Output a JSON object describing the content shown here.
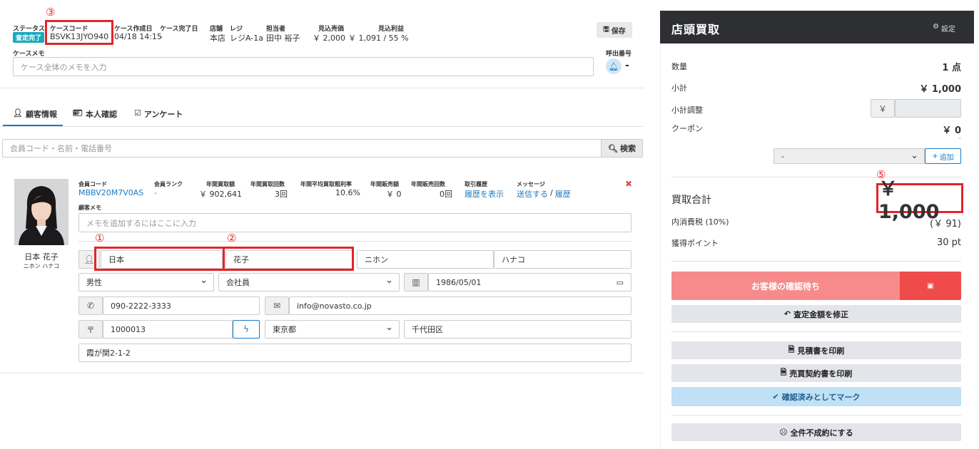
{
  "case": {
    "status_label": "ステータス",
    "status_badge": "査定完了",
    "code_label": "ケースコード",
    "code_value": "BSVK13JYO940",
    "created_label": "ケース作成日",
    "created_value": "04/18 14:15",
    "completed_label": "ケース完了日",
    "completed_value": "-",
    "store_label": "店舗",
    "store_value": "本店",
    "register_label": "レジ",
    "register_value": "レジA-1a",
    "staff_label": "担当者",
    "staff_value": "田中 裕子",
    "est_sale_label": "見込売価",
    "est_sale_value": "￥ 2,000",
    "est_profit_label": "見込利益",
    "est_profit_value": "￥ 1,091 / 55 %",
    "save_button": "保存",
    "memo_label": "ケースメモ",
    "memo_placeholder": "ケース全体のメモを入力",
    "call_number_label": "呼出番号",
    "call_number_value": "-"
  },
  "annotations": {
    "c1": "①",
    "c2": "②",
    "c3": "③",
    "c5": "⑤"
  },
  "tabs": [
    {
      "label": "顧客情報",
      "icon": "user-icon",
      "active": true
    },
    {
      "label": "本人確認",
      "icon": "id-card-icon",
      "active": false
    },
    {
      "label": "アンケート",
      "icon": "check-square-icon",
      "active": false
    }
  ],
  "search": {
    "placeholder": "会員コード・名前・電話番号",
    "button": "検索"
  },
  "customer": {
    "display_name": "日本 花子",
    "display_kana": "ニホン ハナコ",
    "member_code_label": "会員コード",
    "member_code_value": "MBBV20M7V0AS",
    "member_rank_label": "会員ランク",
    "member_rank_value": "-",
    "annual_buy_label": "年間買取額",
    "annual_buy_value": "￥ 902,641",
    "annual_buy_count_label": "年間買取回数",
    "annual_buy_count_value": "3回",
    "avg_margin_label": "年間平均買取粗利率",
    "avg_margin_value": "10.6%",
    "annual_sale_label": "年間販売額",
    "annual_sale_value": "￥ 0",
    "annual_sale_count_label": "年間販売回数",
    "annual_sale_count_value": "0回",
    "history_label": "取引履歴",
    "history_link": "履歴を表示",
    "message_label": "メッセージ",
    "message_send": "送信する",
    "message_sep": "/",
    "message_history": "履歴",
    "memo_label": "顧客メモ",
    "memo_placeholder": "メモを追加するにはここに入力",
    "last_name": "日本",
    "first_name": "花子",
    "last_kana": "ニホン",
    "first_kana": "ハナコ",
    "gender": "男性",
    "occupation": "会社員",
    "birthday": "1986/05/01",
    "phone": "090-2222-3333",
    "email": "info@novasto.co.jp",
    "postal_icon_text": "〒",
    "postal": "1000013",
    "prefecture": "東京都",
    "city": "千代田区",
    "address": "霞が関2-1-2"
  },
  "right_panel": {
    "title": "店頭買取",
    "settings": "設定",
    "qty_label": "数量",
    "qty_value": "1 点",
    "subtotal_label": "小計",
    "subtotal_value": "￥ 1,000",
    "adjust_label": "小計調整",
    "adjust_currency": "￥",
    "coupon_label": "クーポン",
    "coupon_value": "￥ 0",
    "coupon_sub": "-",
    "coupon_select": "-",
    "add_button": "追加",
    "total_label": "買取合計",
    "total_value": "￥ 1,000",
    "tax_label": "内消費税 (10%)",
    "tax_value": "(￥ 91)",
    "points_label": "獲得ポイント",
    "points_value": "30 pt",
    "confirm_wait_button": "お客様の確認待ち",
    "fix_amount_button": "査定金額を修正",
    "print_estimate_button": "見積書を印刷",
    "print_contract_button": "売買契約書を印刷",
    "mark_confirmed_button": "確認済みとしてマーク",
    "cancel_all_button": "全件不成約にする"
  },
  "colors": {
    "badge": "#1aa9bc",
    "header_dark": "#2e2f33",
    "pink": "#f78b8b",
    "red": "#ef4b4b",
    "light_blue": "#bfe0f5",
    "link": "#1a7bc4",
    "annotation_red": "#e3242b"
  }
}
